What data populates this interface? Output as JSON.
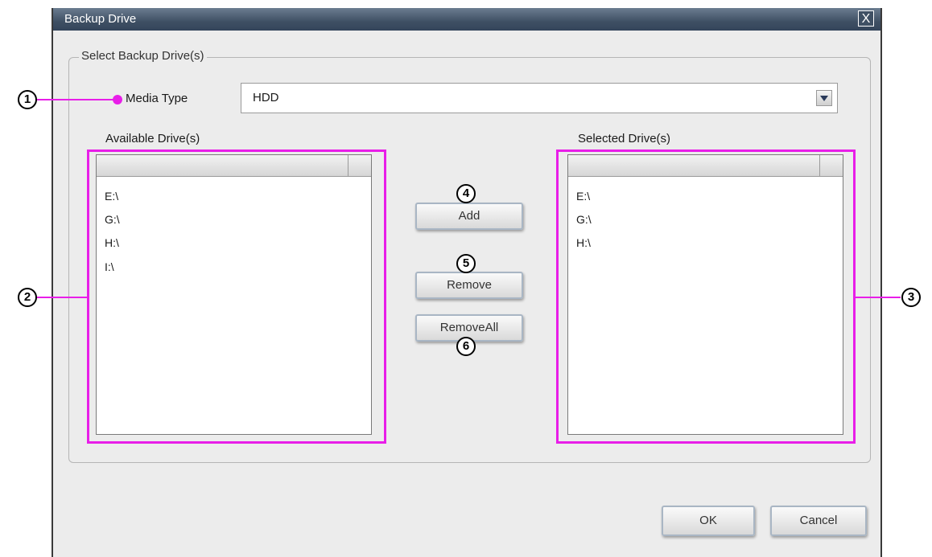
{
  "dialog": {
    "title": "Backup Drive",
    "close_glyph": "X"
  },
  "group": {
    "legend": "Select Backup Drive(s)"
  },
  "media_type": {
    "label": "Media Type",
    "value": "HDD"
  },
  "available": {
    "label": "Available Drive(s)",
    "items": [
      "E:\\",
      "G:\\",
      "H:\\",
      "I:\\"
    ]
  },
  "selected": {
    "label": "Selected Drive(s)",
    "items": [
      "E:\\",
      "G:\\",
      "H:\\"
    ]
  },
  "buttons": {
    "add": "Add",
    "remove": "Remove",
    "remove_all": "RemoveAll",
    "ok": "OK",
    "cancel": "Cancel"
  },
  "callouts": [
    "1",
    "2",
    "3",
    "4",
    "5",
    "6"
  ],
  "colors": {
    "highlight": "#e81ee8",
    "titlebar": "#3f5064"
  },
  "icons": {
    "close": "close-icon",
    "dropdown": "chevron-down-icon"
  }
}
